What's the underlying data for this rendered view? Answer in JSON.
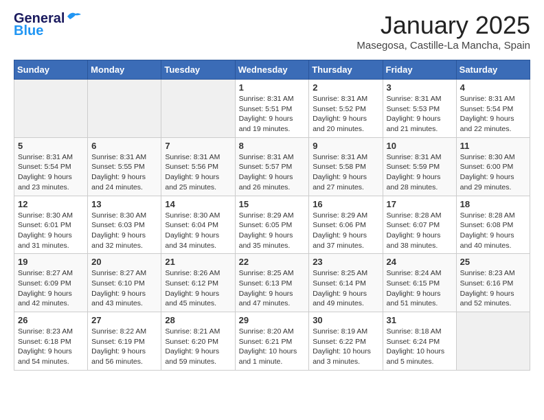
{
  "header": {
    "logo_line1": "General",
    "logo_line2": "Blue",
    "month_title": "January 2025",
    "location": "Masegosa, Castille-La Mancha, Spain"
  },
  "weekdays": [
    "Sunday",
    "Monday",
    "Tuesday",
    "Wednesday",
    "Thursday",
    "Friday",
    "Saturday"
  ],
  "weeks": [
    [
      {
        "day": "",
        "info": ""
      },
      {
        "day": "",
        "info": ""
      },
      {
        "day": "",
        "info": ""
      },
      {
        "day": "1",
        "info": "Sunrise: 8:31 AM\nSunset: 5:51 PM\nDaylight: 9 hours\nand 19 minutes."
      },
      {
        "day": "2",
        "info": "Sunrise: 8:31 AM\nSunset: 5:52 PM\nDaylight: 9 hours\nand 20 minutes."
      },
      {
        "day": "3",
        "info": "Sunrise: 8:31 AM\nSunset: 5:53 PM\nDaylight: 9 hours\nand 21 minutes."
      },
      {
        "day": "4",
        "info": "Sunrise: 8:31 AM\nSunset: 5:54 PM\nDaylight: 9 hours\nand 22 minutes."
      }
    ],
    [
      {
        "day": "5",
        "info": "Sunrise: 8:31 AM\nSunset: 5:54 PM\nDaylight: 9 hours\nand 23 minutes."
      },
      {
        "day": "6",
        "info": "Sunrise: 8:31 AM\nSunset: 5:55 PM\nDaylight: 9 hours\nand 24 minutes."
      },
      {
        "day": "7",
        "info": "Sunrise: 8:31 AM\nSunset: 5:56 PM\nDaylight: 9 hours\nand 25 minutes."
      },
      {
        "day": "8",
        "info": "Sunrise: 8:31 AM\nSunset: 5:57 PM\nDaylight: 9 hours\nand 26 minutes."
      },
      {
        "day": "9",
        "info": "Sunrise: 8:31 AM\nSunset: 5:58 PM\nDaylight: 9 hours\nand 27 minutes."
      },
      {
        "day": "10",
        "info": "Sunrise: 8:31 AM\nSunset: 5:59 PM\nDaylight: 9 hours\nand 28 minutes."
      },
      {
        "day": "11",
        "info": "Sunrise: 8:30 AM\nSunset: 6:00 PM\nDaylight: 9 hours\nand 29 minutes."
      }
    ],
    [
      {
        "day": "12",
        "info": "Sunrise: 8:30 AM\nSunset: 6:01 PM\nDaylight: 9 hours\nand 31 minutes."
      },
      {
        "day": "13",
        "info": "Sunrise: 8:30 AM\nSunset: 6:03 PM\nDaylight: 9 hours\nand 32 minutes."
      },
      {
        "day": "14",
        "info": "Sunrise: 8:30 AM\nSunset: 6:04 PM\nDaylight: 9 hours\nand 34 minutes."
      },
      {
        "day": "15",
        "info": "Sunrise: 8:29 AM\nSunset: 6:05 PM\nDaylight: 9 hours\nand 35 minutes."
      },
      {
        "day": "16",
        "info": "Sunrise: 8:29 AM\nSunset: 6:06 PM\nDaylight: 9 hours\nand 37 minutes."
      },
      {
        "day": "17",
        "info": "Sunrise: 8:28 AM\nSunset: 6:07 PM\nDaylight: 9 hours\nand 38 minutes."
      },
      {
        "day": "18",
        "info": "Sunrise: 8:28 AM\nSunset: 6:08 PM\nDaylight: 9 hours\nand 40 minutes."
      }
    ],
    [
      {
        "day": "19",
        "info": "Sunrise: 8:27 AM\nSunset: 6:09 PM\nDaylight: 9 hours\nand 42 minutes."
      },
      {
        "day": "20",
        "info": "Sunrise: 8:27 AM\nSunset: 6:10 PM\nDaylight: 9 hours\nand 43 minutes."
      },
      {
        "day": "21",
        "info": "Sunrise: 8:26 AM\nSunset: 6:12 PM\nDaylight: 9 hours\nand 45 minutes."
      },
      {
        "day": "22",
        "info": "Sunrise: 8:25 AM\nSunset: 6:13 PM\nDaylight: 9 hours\nand 47 minutes."
      },
      {
        "day": "23",
        "info": "Sunrise: 8:25 AM\nSunset: 6:14 PM\nDaylight: 9 hours\nand 49 minutes."
      },
      {
        "day": "24",
        "info": "Sunrise: 8:24 AM\nSunset: 6:15 PM\nDaylight: 9 hours\nand 51 minutes."
      },
      {
        "day": "25",
        "info": "Sunrise: 8:23 AM\nSunset: 6:16 PM\nDaylight: 9 hours\nand 52 minutes."
      }
    ],
    [
      {
        "day": "26",
        "info": "Sunrise: 8:23 AM\nSunset: 6:18 PM\nDaylight: 9 hours\nand 54 minutes."
      },
      {
        "day": "27",
        "info": "Sunrise: 8:22 AM\nSunset: 6:19 PM\nDaylight: 9 hours\nand 56 minutes."
      },
      {
        "day": "28",
        "info": "Sunrise: 8:21 AM\nSunset: 6:20 PM\nDaylight: 9 hours\nand 59 minutes."
      },
      {
        "day": "29",
        "info": "Sunrise: 8:20 AM\nSunset: 6:21 PM\nDaylight: 10 hours\nand 1 minute."
      },
      {
        "day": "30",
        "info": "Sunrise: 8:19 AM\nSunset: 6:22 PM\nDaylight: 10 hours\nand 3 minutes."
      },
      {
        "day": "31",
        "info": "Sunrise: 8:18 AM\nSunset: 6:24 PM\nDaylight: 10 hours\nand 5 minutes."
      },
      {
        "day": "",
        "info": ""
      }
    ]
  ]
}
